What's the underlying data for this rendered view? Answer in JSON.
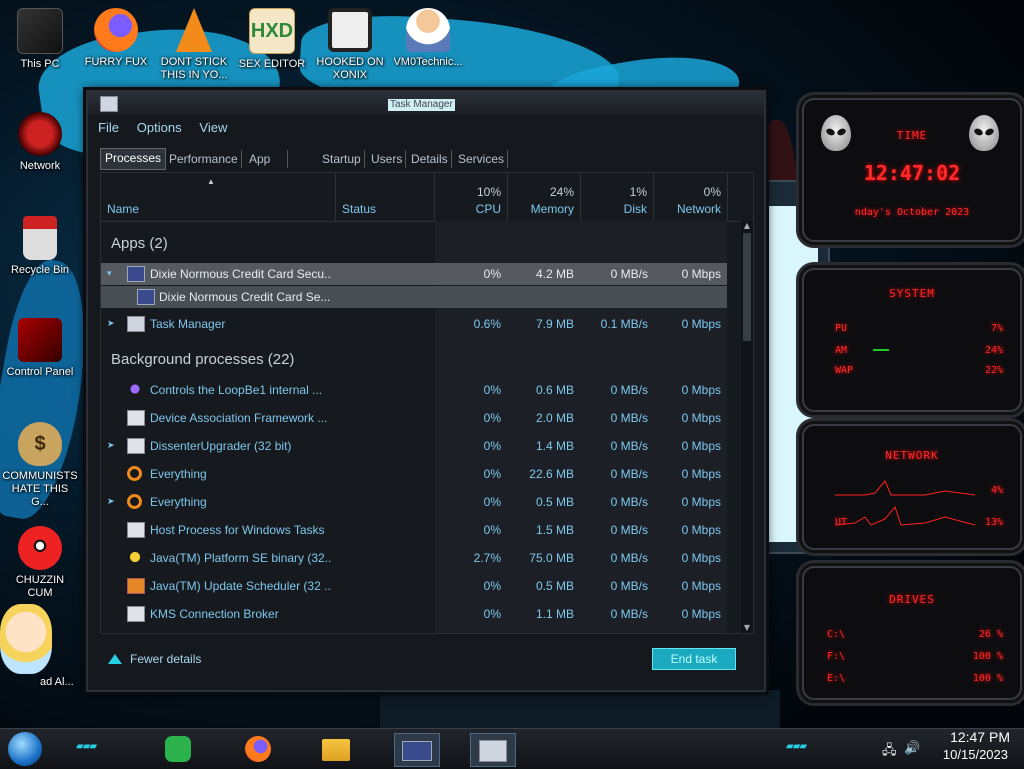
{
  "desktop": {
    "icons": [
      {
        "label": "This PC",
        "icon": "this-pc-icon"
      },
      {
        "label": "FURRY FUX",
        "icon": "firefox-icon"
      },
      {
        "label": "DONT STICK THIS IN YO...",
        "icon": "vlc-cone-icon"
      },
      {
        "label": "SEX EDITOR",
        "icon": "hxd-editor-icon"
      },
      {
        "label": "HOOKED ON XONIX",
        "icon": "xonix-game-icon"
      },
      {
        "label": "VM0Technic...",
        "icon": "doctor-icon"
      },
      {
        "label": "Network",
        "icon": "network-icon"
      },
      {
        "label": "Recycle Bin",
        "icon": "recycle-bin-icon"
      },
      {
        "label": "Control Panel",
        "icon": "control-panel-icon"
      },
      {
        "label": "COMMUNISTS HATE THIS G...",
        "icon": "money-bag-icon"
      },
      {
        "label": "CHUZZIN CUM",
        "icon": "chuzzle-icon"
      },
      {
        "label": "ad Al...",
        "icon": "cartoon-star-icon"
      }
    ]
  },
  "task_manager": {
    "title": "Task Manager",
    "menu": [
      "File",
      "Options",
      "View"
    ],
    "tabs": [
      "Processes",
      "Performance",
      "App history",
      "Startup",
      "Users",
      "Details",
      "Services"
    ],
    "active_tab": "Processes",
    "columns": {
      "name": "Name",
      "status": "Status",
      "cpu": {
        "pct": "10%",
        "label": "CPU"
      },
      "memory": {
        "pct": "24%",
        "label": "Memory"
      },
      "disk": {
        "pct": "1%",
        "label": "Disk"
      },
      "network": {
        "pct": "0%",
        "label": "Network"
      }
    },
    "apps_group": "Apps (2)",
    "background_group": "Background processes (22)",
    "apps": [
      {
        "name": "Dixie Normous Credit Card Secu...",
        "cpu": "0%",
        "memory": "4.2 MB",
        "disk": "0 MB/s",
        "network": "0 Mbps",
        "icon": "credit-card-app-icon",
        "selected": true
      },
      {
        "name": "Dixie Normous Credit Card Se...",
        "icon": "credit-card-app-icon",
        "child": true
      },
      {
        "name": "Task Manager",
        "cpu": "0.6%",
        "memory": "7.9 MB",
        "disk": "0.1 MB/s",
        "network": "0 Mbps",
        "icon": "task-manager-icon"
      }
    ],
    "background": [
      {
        "name": "Controls the LoopBe1 internal ...",
        "cpu": "0%",
        "memory": "0.6 MB",
        "disk": "0 MB/s",
        "network": "0 Mbps",
        "icon": "loopbe-icon",
        "expand": false
      },
      {
        "name": "Device Association Framework ...",
        "cpu": "0%",
        "memory": "2.0 MB",
        "disk": "0 MB/s",
        "network": "0 Mbps",
        "icon": "window-process-icon",
        "expand": false
      },
      {
        "name": "DissenterUpgrader (32 bit)",
        "cpu": "0%",
        "memory": "1.4 MB",
        "disk": "0 MB/s",
        "network": "0 Mbps",
        "icon": "window-process-icon",
        "expand": true
      },
      {
        "name": "Everything",
        "cpu": "0%",
        "memory": "22.6 MB",
        "disk": "0 MB/s",
        "network": "0 Mbps",
        "icon": "magnifier-icon",
        "expand": false
      },
      {
        "name": "Everything",
        "cpu": "0%",
        "memory": "0.5 MB",
        "disk": "0 MB/s",
        "network": "0 Mbps",
        "icon": "magnifier-icon",
        "expand": true
      },
      {
        "name": "Host Process for Windows Tasks",
        "cpu": "0%",
        "memory": "1.5 MB",
        "disk": "0 MB/s",
        "network": "0 Mbps",
        "icon": "window-process-icon",
        "expand": false
      },
      {
        "name": "Java(TM) Platform SE binary (32...",
        "cpu": "2.7%",
        "memory": "75.0 MB",
        "disk": "0 MB/s",
        "network": "0 Mbps",
        "icon": "java-star-icon",
        "expand": false
      },
      {
        "name": "Java(TM) Update Scheduler (32 ...",
        "cpu": "0%",
        "memory": "0.5 MB",
        "disk": "0 MB/s",
        "network": "0 Mbps",
        "icon": "java-update-icon",
        "expand": false
      },
      {
        "name": "KMS Connection Broker",
        "cpu": "0%",
        "memory": "1.1 MB",
        "disk": "0 MB/s",
        "network": "0 Mbps",
        "icon": "window-process-icon",
        "expand": false
      }
    ],
    "fewer_details": "Fewer details",
    "end_task": "End task"
  },
  "gadgets": {
    "time": {
      "title": "TIME",
      "clock": "12:47:02",
      "date": "nday's October 2023"
    },
    "system": {
      "title": "SYSTEM",
      "cpu_label": "PU",
      "cpu": "7%",
      "ram_label": "AM",
      "ram": "24%",
      "swap_label": "WAP",
      "swap": "22%"
    },
    "network": {
      "title": "NETWORK",
      "in": "4%",
      "out_label": "UT",
      "out": "13%"
    },
    "drives": {
      "title": "DRIVES",
      "items": [
        {
          "label": "C:\\",
          "value": "26 %"
        },
        {
          "label": "F:\\",
          "value": "100 %"
        },
        {
          "label": "E:\\",
          "value": "100 %"
        }
      ]
    }
  },
  "taskbar": {
    "time": "12:47 PM",
    "date": "10/15/2023",
    "apps": [
      "feedly-icon",
      "firefox-icon",
      "file-explorer-icon",
      "credit-card-app-icon",
      "task-manager-icon"
    ]
  },
  "colors": {
    "accent": "#7ec8ee",
    "cyan_button": "#1aa9bf",
    "gadget_red": "#ff2b2b"
  }
}
